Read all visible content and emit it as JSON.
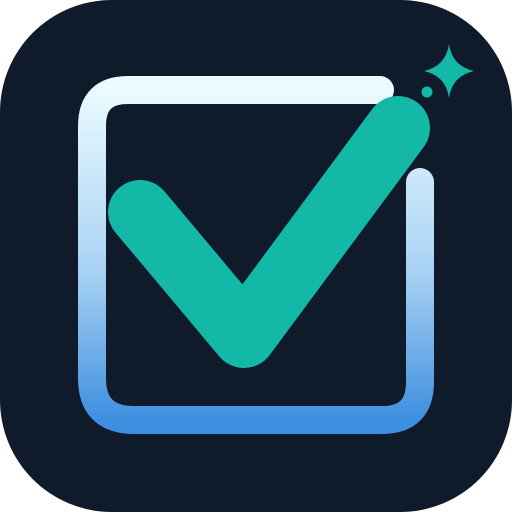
{
  "icon": {
    "name": "checkbox-check-app-icon",
    "colors": {
      "background": "#0F1A2B",
      "check": "#14B8A6",
      "sparkle": "#14B8A6",
      "box_gradient_top": "#EAFBFF",
      "box_gradient_mid": "#A8D2F3",
      "box_gradient_bottom": "#3E8FE0"
    }
  }
}
